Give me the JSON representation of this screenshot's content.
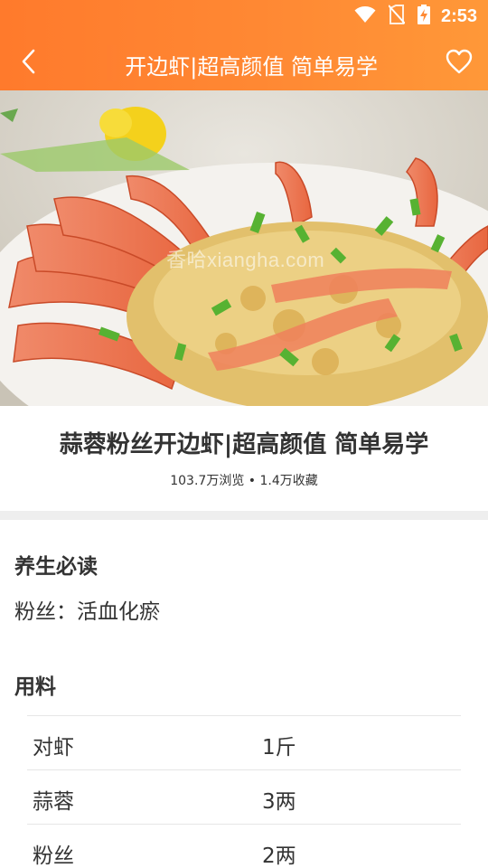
{
  "status_bar": {
    "time": "2:53",
    "icons": [
      "wifi-icon",
      "no-sim-icon",
      "battery-charging-icon"
    ]
  },
  "nav": {
    "title": "开边虾|超高颜值 简单易学",
    "back_icon": "chevron-left-icon",
    "favorite_icon": "heart-outline-icon"
  },
  "hero": {
    "watermark": "香哈xiangha.com"
  },
  "recipe": {
    "title": "蒜蓉粉丝开边虾|超高颜值 简单易学",
    "stats": "103.7万浏览 • 1.4万收藏"
  },
  "health": {
    "heading": "养生必读",
    "text": "粉丝：活血化瘀"
  },
  "ingredients": {
    "heading": "用料",
    "items": [
      {
        "name": "对虾",
        "amount": "1斤"
      },
      {
        "name": "蒜蓉",
        "amount": "3两"
      },
      {
        "name": "粉丝",
        "amount": "2两"
      }
    ]
  },
  "colors": {
    "header_start": "#ff7a2c",
    "header_end": "#ff9838",
    "text_primary": "#333333",
    "divider": "#eeeeee"
  }
}
